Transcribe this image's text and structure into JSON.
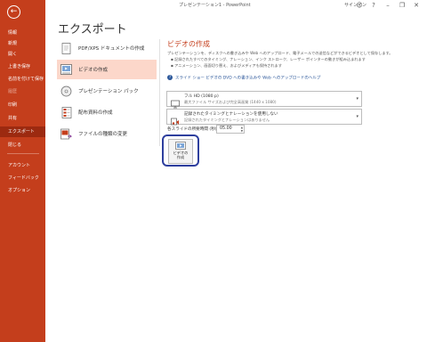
{
  "titlebar": {
    "title": "プレゼンテーション1  -  PowerPoint",
    "signin": "サインイン",
    "controls": [
      "☺",
      "?",
      "–",
      "❐",
      "✕"
    ]
  },
  "nav": {
    "back_icon": "back-arrow-icon",
    "items": [
      {
        "label": "情報",
        "state": "normal"
      },
      {
        "label": "新規",
        "state": "normal"
      },
      {
        "label": "開く",
        "state": "normal"
      },
      {
        "label": "上書き保存",
        "state": "normal"
      },
      {
        "label": "名前を付けて保存",
        "state": "normal"
      },
      {
        "label": "履歴",
        "state": "disabled"
      },
      {
        "label": "印刷",
        "state": "normal"
      },
      {
        "label": "共有",
        "state": "normal"
      },
      {
        "label": "エクスポート",
        "state": "active"
      },
      {
        "label": "閉じる",
        "state": "normal"
      },
      {
        "label": "アカウント",
        "state": "normal"
      },
      {
        "label": "フィードバック",
        "state": "normal"
      },
      {
        "label": "オプション",
        "state": "normal"
      }
    ]
  },
  "page_title": "エクスポート",
  "options": [
    {
      "label": "PDF/XPS ドキュメントの作成",
      "icon": "pdf-document-icon"
    },
    {
      "label": "ビデオの作成",
      "icon": "video-icon"
    },
    {
      "label": "プレゼンテーション パック",
      "icon": "cd-package-icon"
    },
    {
      "label": "配布資料の作成",
      "icon": "handouts-icon"
    },
    {
      "label": "ファイルの種類の変更",
      "icon": "file-type-icon"
    }
  ],
  "video": {
    "title": "ビデオの作成",
    "description": "プレゼンテーションを、ディスクへの書き込みや Web へのアップロード、電子メールでの送信などができるビデオとして保存します。",
    "bullets": [
      "記録されたすべてのタイミング、ナレーション、インク ストローク、レーザー ポインターの動きが組み込まれます",
      "アニメーション、画面切り替え、およびメディアも保持されます"
    ],
    "help_link": "スライド ショー ビデオの DVD への書き込みや Web へのアップロードのヘルプ",
    "quality": {
      "title": "フル HD (1080 p)",
      "subtitle": "最大ファイル サイズおよび完全高画質 (1440 x 1080)"
    },
    "timing": {
      "title": "記録されたタイミングとナレーションを使用しない",
      "subtitle": "記録されたタイミングとナレーションはありません"
    },
    "seconds_label": "各スライドの所要時間 (秒):",
    "seconds_value": "05.00",
    "create_button": [
      "ビデオの",
      "作成"
    ]
  },
  "colors": {
    "accent": "#c43e1c",
    "active_nav": "#9c2a10",
    "selected_option": "#fcd7ca",
    "link": "#2b579a",
    "highlight": "#2e3f9e"
  }
}
